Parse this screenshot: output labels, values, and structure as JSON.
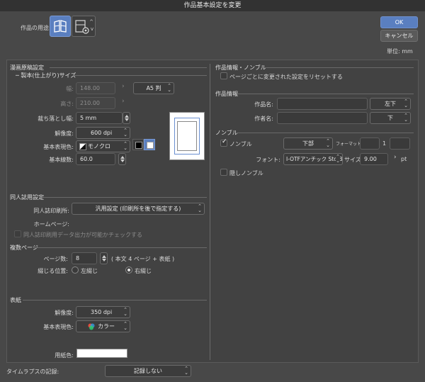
{
  "window": {
    "title": "作品基本設定を変更"
  },
  "usage": {
    "label": "作品の用途:",
    "options": [
      "comic-usage-icon",
      "illustration-usage-icon"
    ]
  },
  "buttons": {
    "ok": "OK",
    "cancel": "キャンセル"
  },
  "unit": {
    "label": "単位:",
    "value": "mm"
  },
  "manga": {
    "section": "漫画原稿設定",
    "bound_size": "製本(仕上がり)サイズ",
    "width": {
      "label": "幅:",
      "value": "148.00"
    },
    "height": {
      "label": "高さ:",
      "value": "210.00"
    },
    "paper_size": "A5 判",
    "bleed": {
      "label": "裁ち落とし幅:",
      "value": "5 mm"
    },
    "resolution": {
      "label": "解像度:",
      "value": "600 dpi"
    },
    "color_mode": {
      "label": "基本表現色:",
      "value": "モノクロ"
    },
    "line_count": {
      "label": "基本線数:",
      "value": "60.0"
    }
  },
  "doujin": {
    "section": "同人誌用設定",
    "printer": {
      "label": "同人誌印刷所:",
      "value": "汎用設定 (印刷所を後で指定する)"
    },
    "homepage": {
      "label": "ホームページ:"
    },
    "check": {
      "label": "同人誌印刷用データ出力が可能かチェックする"
    }
  },
  "multipage": {
    "section": "複数ページ",
    "pages": {
      "label": "ページ数:",
      "value": "8",
      "note": "( 本文 4 ページ + 表紙 )"
    },
    "binding": {
      "label": "綴じる位置:",
      "left": "左綴じ",
      "right": "右綴じ"
    }
  },
  "cover": {
    "section": "表紙",
    "resolution": {
      "label": "解像度:",
      "value": "350 dpi"
    },
    "color_mode": {
      "label": "基本表現色:",
      "value": "カラー"
    },
    "paper_color": {
      "label": "用紙色:",
      "value": "#ffffff"
    }
  },
  "info_nombre": {
    "section": "作品情報・ノンブル",
    "reset": "ページごとに変更された設定をリセットする",
    "info_section": "作品情報",
    "work_name": {
      "label": "作品名:",
      "position": "左下"
    },
    "author": {
      "label": "作者名:",
      "position": "下"
    },
    "nombre_section": "ノンブル",
    "nombre_check": "ノンブル",
    "nombre_position": "下部",
    "format_label": "フォーマット:",
    "format_number": "1",
    "font": {
      "label": "フォント:",
      "value": "I-OTFアンチック Std B"
    },
    "size": {
      "label": "サイズ:",
      "value": "9.00",
      "unit": "pt"
    },
    "hidden": "隠しノンブル"
  },
  "timelapse": {
    "label": "タイムラプスの記録:",
    "value": "記録しない"
  },
  "colors": {
    "accent": "#5a7fc0",
    "bg": "#484848"
  }
}
